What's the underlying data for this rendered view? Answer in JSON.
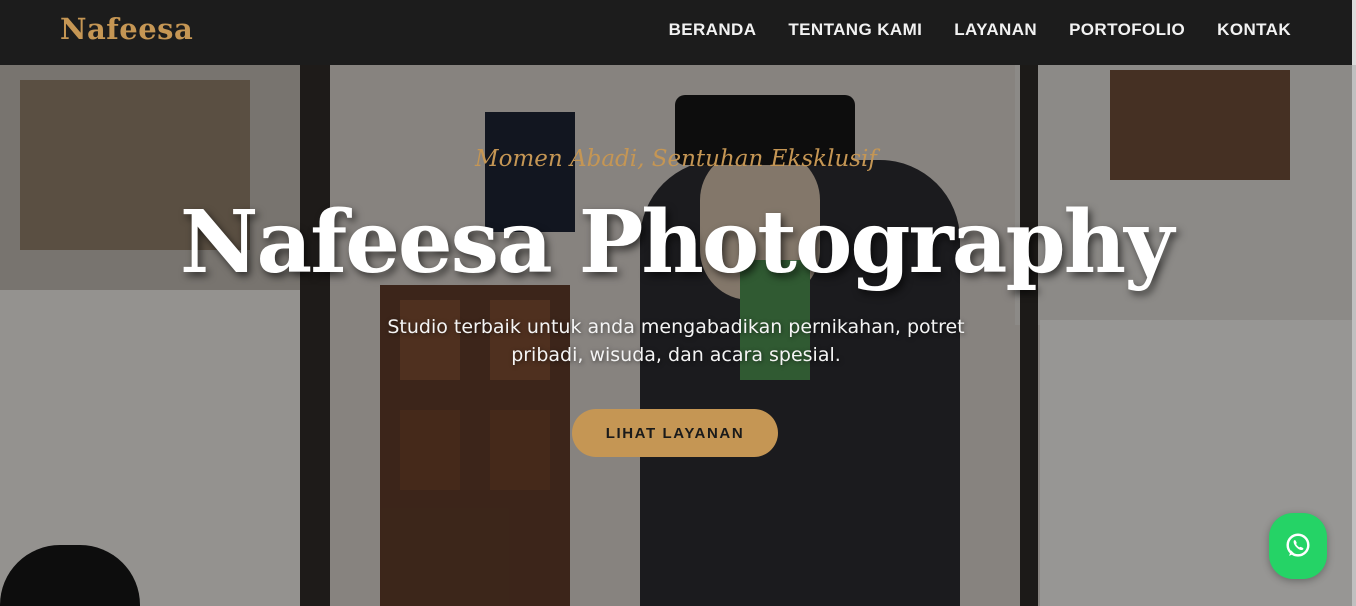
{
  "colors": {
    "accent": "#c59654",
    "navbar": "#1c1c1c",
    "whatsapp": "#25d366"
  },
  "brand": {
    "name": "Nafeesa"
  },
  "nav": {
    "items": [
      "BERANDA",
      "TENTANG KAMI",
      "LAYANAN",
      "PORTOFOLIO",
      "KONTAK"
    ]
  },
  "hero": {
    "tagline": "Momen Abadi, Sentuhan Eksklusif",
    "title": "Nafeesa Photography",
    "description": "Studio terbaik untuk anda mengabadikan pernikahan, potret pribadi, wisuda, dan acara spesial.",
    "cta": "LIHAT LAYANAN"
  },
  "icons": {
    "whatsapp": "whatsapp-icon"
  }
}
